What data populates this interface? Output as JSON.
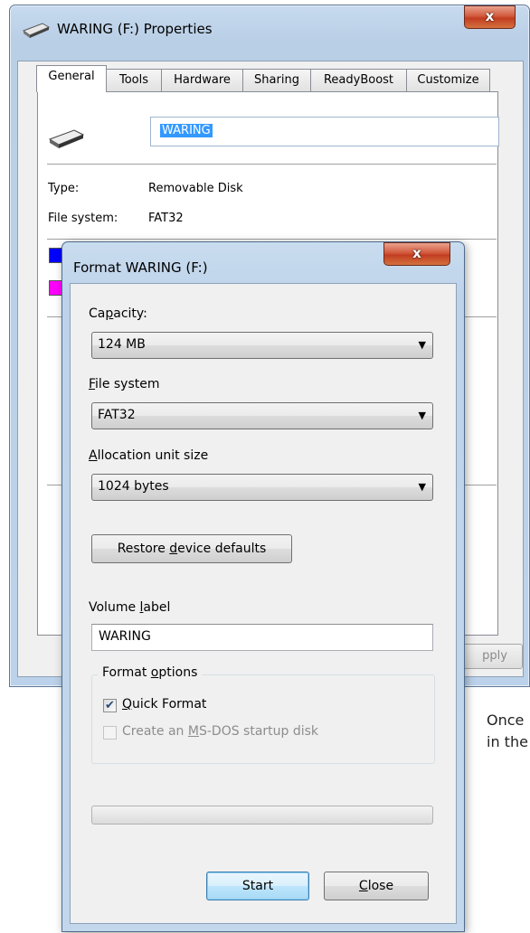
{
  "properties_window": {
    "title": "WARING (F:) Properties",
    "close_label": "x",
    "tabs": [
      "General",
      "Tools",
      "Hardware",
      "Sharing",
      "ReadyBoost",
      "Customize"
    ],
    "active_tab": "General",
    "volume_name": "WARING",
    "type_label": "Type:",
    "type_value": "Removable Disk",
    "fs_label": "File system:",
    "fs_value": "FAT32",
    "used_color": "#0000ff",
    "free_color": "#ff00ff",
    "apply_partial": "pply"
  },
  "format_dialog": {
    "title": "Format WARING (F:)",
    "close_label": "x",
    "capacity": {
      "label_before": "Ca",
      "label_underline": "p",
      "label_after": "acity:",
      "value": "124 MB"
    },
    "file_system": {
      "label_underline": "F",
      "label_after": "ile system",
      "value": "FAT32"
    },
    "allocation": {
      "label_underline": "A",
      "label_after": "llocation unit size",
      "value": "1024 bytes"
    },
    "restore_button": {
      "before": "Restore ",
      "underline": "d",
      "after": "evice defaults"
    },
    "volume_label": {
      "label_before": "Volume ",
      "label_underline": "l",
      "label_after": "abel",
      "value": "WARING"
    },
    "format_options": {
      "before": "Format ",
      "underline": "o",
      "after": "ptions"
    },
    "quick_format": {
      "underline": "Q",
      "after": "uick Format",
      "checked": true
    },
    "msdos": {
      "before": "Create an ",
      "underline": "M",
      "after": "S-DOS startup disk",
      "checked": false,
      "enabled": false
    },
    "progress_percent": 0,
    "start_label": "Start",
    "close_button": {
      "underline": "C",
      "after": "lose"
    }
  },
  "background_text": [
    "Once",
    "in the"
  ]
}
